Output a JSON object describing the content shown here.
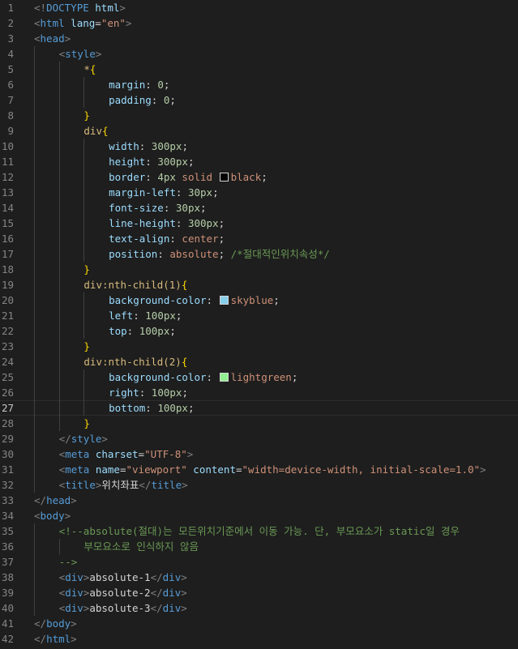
{
  "editor": {
    "language": "html",
    "active_line": 27,
    "lines": [
      {
        "n": "1",
        "indent": 0,
        "tokens": [
          [
            "c-br",
            "<!"
          ],
          [
            "c-tag",
            "DOCTYPE"
          ],
          [
            "c-text",
            " "
          ],
          [
            "c-attr",
            "html"
          ],
          [
            "c-br",
            ">"
          ]
        ]
      },
      {
        "n": "2",
        "indent": 0,
        "tokens": [
          [
            "c-br",
            "<"
          ],
          [
            "c-tag",
            "html"
          ],
          [
            "c-text",
            " "
          ],
          [
            "c-attr",
            "lang"
          ],
          [
            "c-text",
            "="
          ],
          [
            "c-str",
            "\"en\""
          ],
          [
            "c-br",
            ">"
          ]
        ]
      },
      {
        "n": "3",
        "indent": 0,
        "tokens": [
          [
            "c-br",
            "<"
          ],
          [
            "c-tag",
            "head"
          ],
          [
            "c-br",
            ">"
          ]
        ]
      },
      {
        "n": "4",
        "indent": 1,
        "tokens": [
          [
            "c-br",
            "<"
          ],
          [
            "c-tag",
            "style"
          ],
          [
            "c-br",
            ">"
          ]
        ]
      },
      {
        "n": "5",
        "indent": 2,
        "tokens": [
          [
            "c-sel",
            "*"
          ],
          [
            "c-brace",
            "{"
          ]
        ]
      },
      {
        "n": "6",
        "indent": 3,
        "tokens": [
          [
            "c-prop",
            "margin"
          ],
          [
            "c-text",
            ": "
          ],
          [
            "c-num",
            "0"
          ],
          [
            "c-text",
            ";"
          ]
        ]
      },
      {
        "n": "7",
        "indent": 3,
        "tokens": [
          [
            "c-prop",
            "padding"
          ],
          [
            "c-text",
            ": "
          ],
          [
            "c-num",
            "0"
          ],
          [
            "c-text",
            ";"
          ]
        ]
      },
      {
        "n": "8",
        "indent": 2,
        "tokens": [
          [
            "c-brace",
            "}"
          ]
        ]
      },
      {
        "n": "9",
        "indent": 2,
        "tokens": [
          [
            "c-sel",
            "div"
          ],
          [
            "c-brace",
            "{"
          ]
        ]
      },
      {
        "n": "10",
        "indent": 3,
        "tokens": [
          [
            "c-prop",
            "width"
          ],
          [
            "c-text",
            ": "
          ],
          [
            "c-num",
            "300px"
          ],
          [
            "c-text",
            ";"
          ]
        ]
      },
      {
        "n": "11",
        "indent": 3,
        "tokens": [
          [
            "c-prop",
            "height"
          ],
          [
            "c-text",
            ": "
          ],
          [
            "c-num",
            "300px"
          ],
          [
            "c-text",
            ";"
          ]
        ]
      },
      {
        "n": "12",
        "indent": 3,
        "tokens": [
          [
            "c-prop",
            "border"
          ],
          [
            "c-text",
            ": "
          ],
          [
            "c-num",
            "4px"
          ],
          [
            "c-text",
            " "
          ],
          [
            "c-val",
            "solid"
          ],
          [
            "c-text",
            " "
          ],
          [
            "swatch",
            "#000000"
          ],
          [
            "c-val",
            "black"
          ],
          [
            "c-text",
            ";"
          ]
        ]
      },
      {
        "n": "13",
        "indent": 3,
        "tokens": [
          [
            "c-prop",
            "margin-left"
          ],
          [
            "c-text",
            ": "
          ],
          [
            "c-num",
            "30px"
          ],
          [
            "c-text",
            ";"
          ]
        ]
      },
      {
        "n": "14",
        "indent": 3,
        "tokens": [
          [
            "c-prop",
            "font-size"
          ],
          [
            "c-text",
            ": "
          ],
          [
            "c-num",
            "30px"
          ],
          [
            "c-text",
            ";"
          ]
        ]
      },
      {
        "n": "15",
        "indent": 3,
        "tokens": [
          [
            "c-prop",
            "line-height"
          ],
          [
            "c-text",
            ": "
          ],
          [
            "c-num",
            "300px"
          ],
          [
            "c-text",
            ";"
          ]
        ]
      },
      {
        "n": "16",
        "indent": 3,
        "tokens": [
          [
            "c-prop",
            "text-align"
          ],
          [
            "c-text",
            ": "
          ],
          [
            "c-val",
            "center"
          ],
          [
            "c-text",
            ";"
          ]
        ]
      },
      {
        "n": "17",
        "indent": 3,
        "tokens": [
          [
            "c-prop",
            "position"
          ],
          [
            "c-text",
            ": "
          ],
          [
            "c-val",
            "absolute"
          ],
          [
            "c-text",
            "; "
          ],
          [
            "c-cm",
            "/*절대적인위치속성*/"
          ]
        ]
      },
      {
        "n": "18",
        "indent": 2,
        "tokens": [
          [
            "c-brace",
            "}"
          ]
        ]
      },
      {
        "n": "19",
        "indent": 2,
        "tokens": [
          [
            "c-sel",
            "div:nth-child(1)"
          ],
          [
            "c-brace",
            "{"
          ]
        ]
      },
      {
        "n": "20",
        "indent": 3,
        "tokens": [
          [
            "c-prop",
            "background-color"
          ],
          [
            "c-text",
            ": "
          ],
          [
            "swatch",
            "#87ceeb"
          ],
          [
            "c-val",
            "skyblue"
          ],
          [
            "c-text",
            ";"
          ]
        ]
      },
      {
        "n": "21",
        "indent": 3,
        "tokens": [
          [
            "c-prop",
            "left"
          ],
          [
            "c-text",
            ": "
          ],
          [
            "c-num",
            "100px"
          ],
          [
            "c-text",
            ";"
          ]
        ]
      },
      {
        "n": "22",
        "indent": 3,
        "tokens": [
          [
            "c-prop",
            "top"
          ],
          [
            "c-text",
            ": "
          ],
          [
            "c-num",
            "100px"
          ],
          [
            "c-text",
            ";"
          ]
        ]
      },
      {
        "n": "23",
        "indent": 2,
        "tokens": [
          [
            "c-brace",
            "}"
          ]
        ]
      },
      {
        "n": "24",
        "indent": 2,
        "tokens": [
          [
            "c-sel",
            "div:nth-child(2)"
          ],
          [
            "c-brace",
            "{"
          ]
        ]
      },
      {
        "n": "25",
        "indent": 3,
        "tokens": [
          [
            "c-prop",
            "background-color"
          ],
          [
            "c-text",
            ": "
          ],
          [
            "swatch",
            "#90ee90"
          ],
          [
            "c-val",
            "lightgreen"
          ],
          [
            "c-text",
            ";"
          ]
        ]
      },
      {
        "n": "26",
        "indent": 3,
        "tokens": [
          [
            "c-prop",
            "right"
          ],
          [
            "c-text",
            ": "
          ],
          [
            "c-num",
            "100px"
          ],
          [
            "c-text",
            ";"
          ]
        ]
      },
      {
        "n": "27",
        "indent": 3,
        "tokens": [
          [
            "c-prop",
            "bottom"
          ],
          [
            "c-text",
            ": "
          ],
          [
            "c-num",
            "100px"
          ],
          [
            "c-text",
            ";"
          ]
        ]
      },
      {
        "n": "28",
        "indent": 2,
        "tokens": [
          [
            "c-brace",
            "}"
          ]
        ]
      },
      {
        "n": "29",
        "indent": 1,
        "tokens": [
          [
            "c-br",
            "</"
          ],
          [
            "c-tag",
            "style"
          ],
          [
            "c-br",
            ">"
          ]
        ]
      },
      {
        "n": "30",
        "indent": 1,
        "tokens": [
          [
            "c-br",
            "<"
          ],
          [
            "c-tag",
            "meta"
          ],
          [
            "c-text",
            " "
          ],
          [
            "c-attr",
            "charset"
          ],
          [
            "c-text",
            "="
          ],
          [
            "c-str",
            "\"UTF-8\""
          ],
          [
            "c-br",
            ">"
          ]
        ]
      },
      {
        "n": "31",
        "indent": 1,
        "tokens": [
          [
            "c-br",
            "<"
          ],
          [
            "c-tag",
            "meta"
          ],
          [
            "c-text",
            " "
          ],
          [
            "c-attr",
            "name"
          ],
          [
            "c-text",
            "="
          ],
          [
            "c-str",
            "\"viewport\""
          ],
          [
            "c-text",
            " "
          ],
          [
            "c-attr",
            "content"
          ],
          [
            "c-text",
            "="
          ],
          [
            "c-str",
            "\"width=device-width, initial-scale=1.0\""
          ],
          [
            "c-br",
            ">"
          ]
        ]
      },
      {
        "n": "32",
        "indent": 1,
        "tokens": [
          [
            "c-br",
            "<"
          ],
          [
            "c-tag",
            "title"
          ],
          [
            "c-br",
            ">"
          ],
          [
            "c-text",
            "위치좌표"
          ],
          [
            "c-br",
            "</"
          ],
          [
            "c-tag",
            "title"
          ],
          [
            "c-br",
            ">"
          ]
        ]
      },
      {
        "n": "33",
        "indent": 0,
        "tokens": [
          [
            "c-br",
            "</"
          ],
          [
            "c-tag",
            "head"
          ],
          [
            "c-br",
            ">"
          ]
        ]
      },
      {
        "n": "34",
        "indent": 0,
        "tokens": [
          [
            "c-br",
            "<"
          ],
          [
            "c-tag",
            "body"
          ],
          [
            "c-br",
            ">"
          ]
        ]
      },
      {
        "n": "35",
        "indent": 1,
        "tokens": [
          [
            "c-cm",
            "<!--absolute(절대)는 모든위치기준에서 이동 가능. 단, 부모요소가 static일 경우"
          ]
        ]
      },
      {
        "n": "36",
        "indent": 2,
        "tokens": [
          [
            "c-cm",
            "부모요소로 인식하지 않음"
          ]
        ]
      },
      {
        "n": "37",
        "indent": 1,
        "tokens": [
          [
            "c-cm",
            "-->"
          ]
        ]
      },
      {
        "n": "38",
        "indent": 1,
        "tokens": [
          [
            "c-br",
            "<"
          ],
          [
            "c-tag",
            "div"
          ],
          [
            "c-br",
            ">"
          ],
          [
            "c-text",
            "absolute-1"
          ],
          [
            "c-br",
            "</"
          ],
          [
            "c-tag",
            "div"
          ],
          [
            "c-br",
            ">"
          ]
        ]
      },
      {
        "n": "39",
        "indent": 1,
        "tokens": [
          [
            "c-br",
            "<"
          ],
          [
            "c-tag",
            "div"
          ],
          [
            "c-br",
            ">"
          ],
          [
            "c-text",
            "absolute-2"
          ],
          [
            "c-br",
            "</"
          ],
          [
            "c-tag",
            "div"
          ],
          [
            "c-br",
            ">"
          ]
        ]
      },
      {
        "n": "40",
        "indent": 1,
        "tokens": [
          [
            "c-br",
            "<"
          ],
          [
            "c-tag",
            "div"
          ],
          [
            "c-br",
            ">"
          ],
          [
            "c-text",
            "absolute-3"
          ],
          [
            "c-br",
            "</"
          ],
          [
            "c-tag",
            "div"
          ],
          [
            "c-br",
            ">"
          ]
        ]
      },
      {
        "n": "41",
        "indent": 0,
        "tokens": [
          [
            "c-br",
            "</"
          ],
          [
            "c-tag",
            "body"
          ],
          [
            "c-br",
            ">"
          ]
        ]
      },
      {
        "n": "42",
        "indent": 0,
        "tokens": [
          [
            "c-br",
            "</"
          ],
          [
            "c-tag",
            "html"
          ],
          [
            "c-br",
            ">"
          ]
        ]
      }
    ]
  }
}
